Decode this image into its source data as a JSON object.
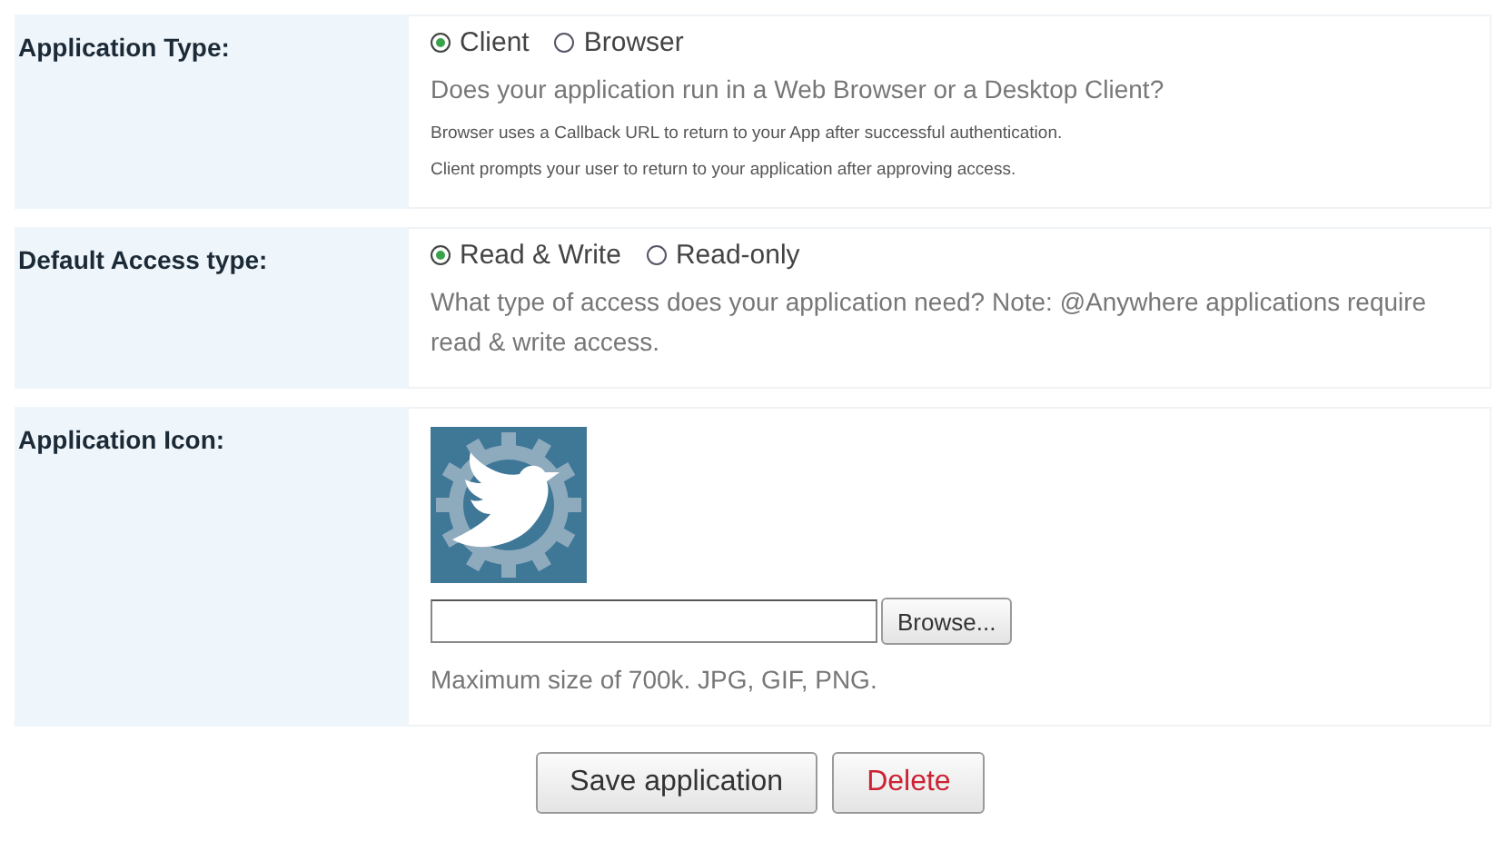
{
  "sections": [
    {
      "kind": "choice",
      "label": "Application Type:",
      "options": [
        {
          "label": "Client",
          "selected": true
        },
        {
          "label": "Browser",
          "selected": false
        }
      ],
      "notes": [
        {
          "kind": "main",
          "text": "Does your application run in a Web Browser or a Desktop Client?"
        },
        {
          "kind": "small",
          "text": "Browser uses a Callback URL to return to your App after successful authentication."
        },
        {
          "kind": "small",
          "text": "Client prompts your user to return to your application after approving access."
        }
      ]
    },
    {
      "kind": "choice",
      "label": "Default Access type:",
      "options": [
        {
          "label": "Read & Write",
          "selected": true
        },
        {
          "label": "Read-only",
          "selected": false
        }
      ],
      "notes": [
        {
          "kind": "main",
          "text": "What type of access does your application need? Note: @Anywhere applications require read & write access."
        }
      ]
    },
    {
      "kind": "upload",
      "label": "Application Icon:",
      "upload": {
        "button": "Browse...",
        "note": "Maximum size of 700k. JPG, GIF, PNG."
      }
    }
  ],
  "buttons": [
    {
      "kind": "primary",
      "label": "Save application"
    },
    {
      "kind": "danger",
      "label": "Delete"
    }
  ]
}
